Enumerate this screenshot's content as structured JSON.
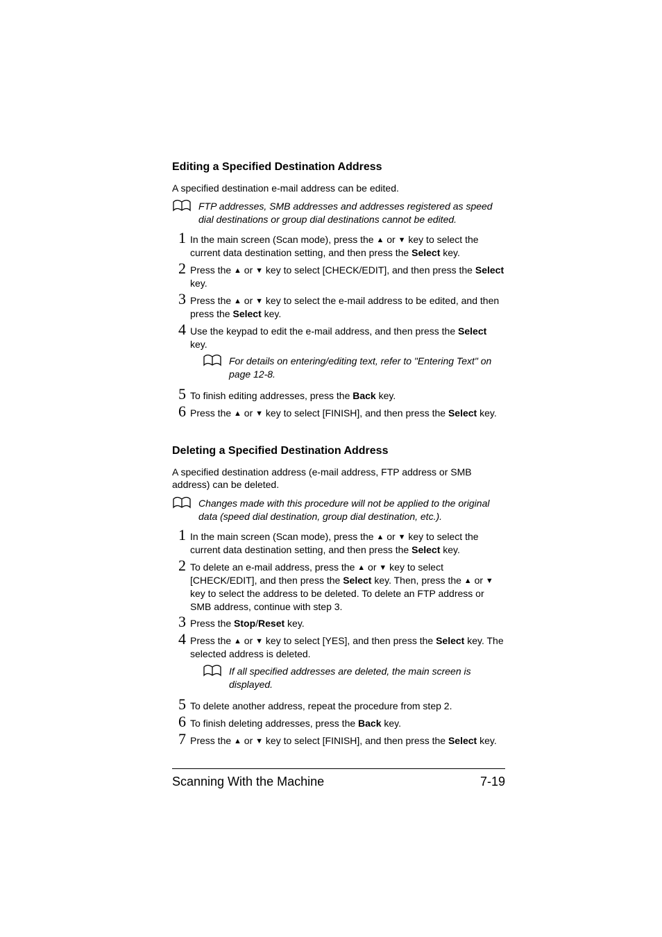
{
  "section1": {
    "heading": "Editing a Specified Destination Address",
    "intro": "A specified destination e-mail address can be edited.",
    "note1": "FTP addresses, SMB addresses and addresses registered as speed dial destinations or group dial destinations cannot be edited.",
    "steps": {
      "s1a": "In the main screen (Scan mode), press the ",
      "s1b": " or ",
      "s1c": " key to select the current data destination setting, and then press the ",
      "s1d": " key.",
      "s2a": "Press the ",
      "s2b": " or ",
      "s2c": " key to select [CHECK/EDIT], and then press the ",
      "s2d": " key.",
      "s3a": "Press the ",
      "s3b": " or ",
      "s3c": " key to select the e-mail address to be edited, and then press the ",
      "s3d": " key.",
      "s4a": "Use the keypad to edit the e-mail address, and then press the ",
      "s4b": " key.",
      "s4note": "For details on entering/editing text, refer to \"Entering Text\" on page 12-8.",
      "s5a": "To finish editing addresses, press the ",
      "s5b": " key.",
      "s6a": "Press the ",
      "s6b": " or ",
      "s6c": " key to select [FINISH], and then press the ",
      "s6d": " key."
    }
  },
  "section2": {
    "heading": "Deleting a Specified Destination Address",
    "intro": "A specified destination address (e-mail address, FTP address or SMB address) can be deleted.",
    "note1": "Changes made with this procedure will not be applied to the original data (speed dial destination, group dial destination, etc.).",
    "steps": {
      "s1a": "In the main screen (Scan mode), press the ",
      "s1b": " or ",
      "s1c": " key to select the current data destination setting, and then press the ",
      "s1d": " key.",
      "s2a": "To delete an e-mail address, press the ",
      "s2b": " or ",
      "s2c": " key to select [CHECK/EDIT], and then press the ",
      "s2d": " key. Then, press the ",
      "s2e": " or ",
      "s2f": " key to select the address to be deleted. To delete an FTP address or SMB address, continue with step 3.",
      "s3a": "Press the ",
      "s3b": " key.",
      "s4a": "Press the ",
      "s4b": " or ",
      "s4c": " key to select [YES], and then press the ",
      "s4d": " key. The selected address is deleted.",
      "s4note": "If all specified addresses are deleted, the main screen is displayed.",
      "s5": "To delete another address, repeat the procedure from step 2.",
      "s6a": "To finish deleting addresses, press the ",
      "s6b": " key.",
      "s7a": "Press the ",
      "s7b": " or ",
      "s7c": " key to select [FINISH], and then press the ",
      "s7d": " key."
    }
  },
  "labels": {
    "select": "Select",
    "back": "Back",
    "stopreset": "Stop",
    "reset": "Reset"
  },
  "footer": {
    "left": "Scanning With the Machine",
    "right": "7-19"
  }
}
